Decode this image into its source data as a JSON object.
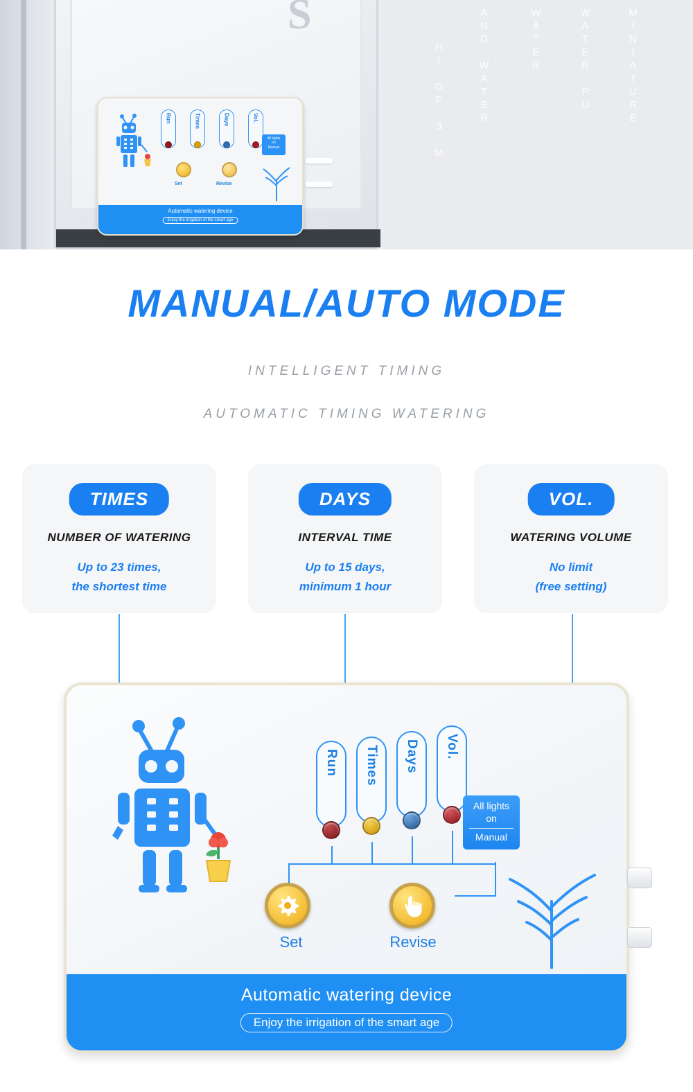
{
  "top_banner": {
    "big_letter": "S",
    "vertical_texts": [
      "MINIATURE",
      "WATER PU",
      "WATER",
      "AND WATER",
      "HT OF 3 M",
      "O F 3"
    ],
    "mini_device": {
      "labels": [
        "Run",
        "Times",
        "Days",
        "Vol."
      ],
      "knob_set": "Set",
      "knob_revise": "Revise",
      "manual_btn": [
        "All lights",
        "on",
        "Manual"
      ],
      "bottom_title": "Automatic watering device",
      "bottom_sub": "Enjoy the irrigation of the smart age"
    }
  },
  "headings": {
    "title": "MANUAL/AUTO MODE",
    "sub1": "INTELLIGENT TIMING",
    "sub2": "AUTOMATIC TIMING WATERING"
  },
  "cards": [
    {
      "pill": "TIMES",
      "subtitle": "NUMBER OF WATERING",
      "body_line1": "Up to 23 times,",
      "body_line2": "the shortest time"
    },
    {
      "pill": "DAYS",
      "subtitle": "INTERVAL TIME",
      "body_line1": "Up to 15 days,",
      "body_line2": "minimum 1 hour"
    },
    {
      "pill": "VOL.",
      "subtitle": "WATERING VOLUME",
      "body_line1": "No limit",
      "body_line2": "(free setting)"
    }
  ],
  "device": {
    "labels": [
      "Run",
      "Times",
      "Days",
      "Vol."
    ],
    "led_colors": [
      "#8e1a1f",
      "#d8a400",
      "#2c6fb5",
      "#a81a20"
    ],
    "knobs": [
      {
        "name": "set",
        "label": "Set",
        "icon": "gear-icon"
      },
      {
        "name": "revise",
        "label": "Revise",
        "icon": "hand-pointer-icon"
      }
    ],
    "manual_button": {
      "line1": "All lights",
      "line2": "on",
      "line3": "Manual"
    },
    "bottom_title": "Automatic watering device",
    "bottom_sub": "Enjoy the irrigation of the smart age"
  },
  "colors": {
    "brand_blue": "#1a7ff0",
    "device_bar_blue": "#1f8ff3",
    "card_bg": "#f4f6f8",
    "sub_gray": "#9aa0a6",
    "knob_yellow": "#f0ad14"
  }
}
